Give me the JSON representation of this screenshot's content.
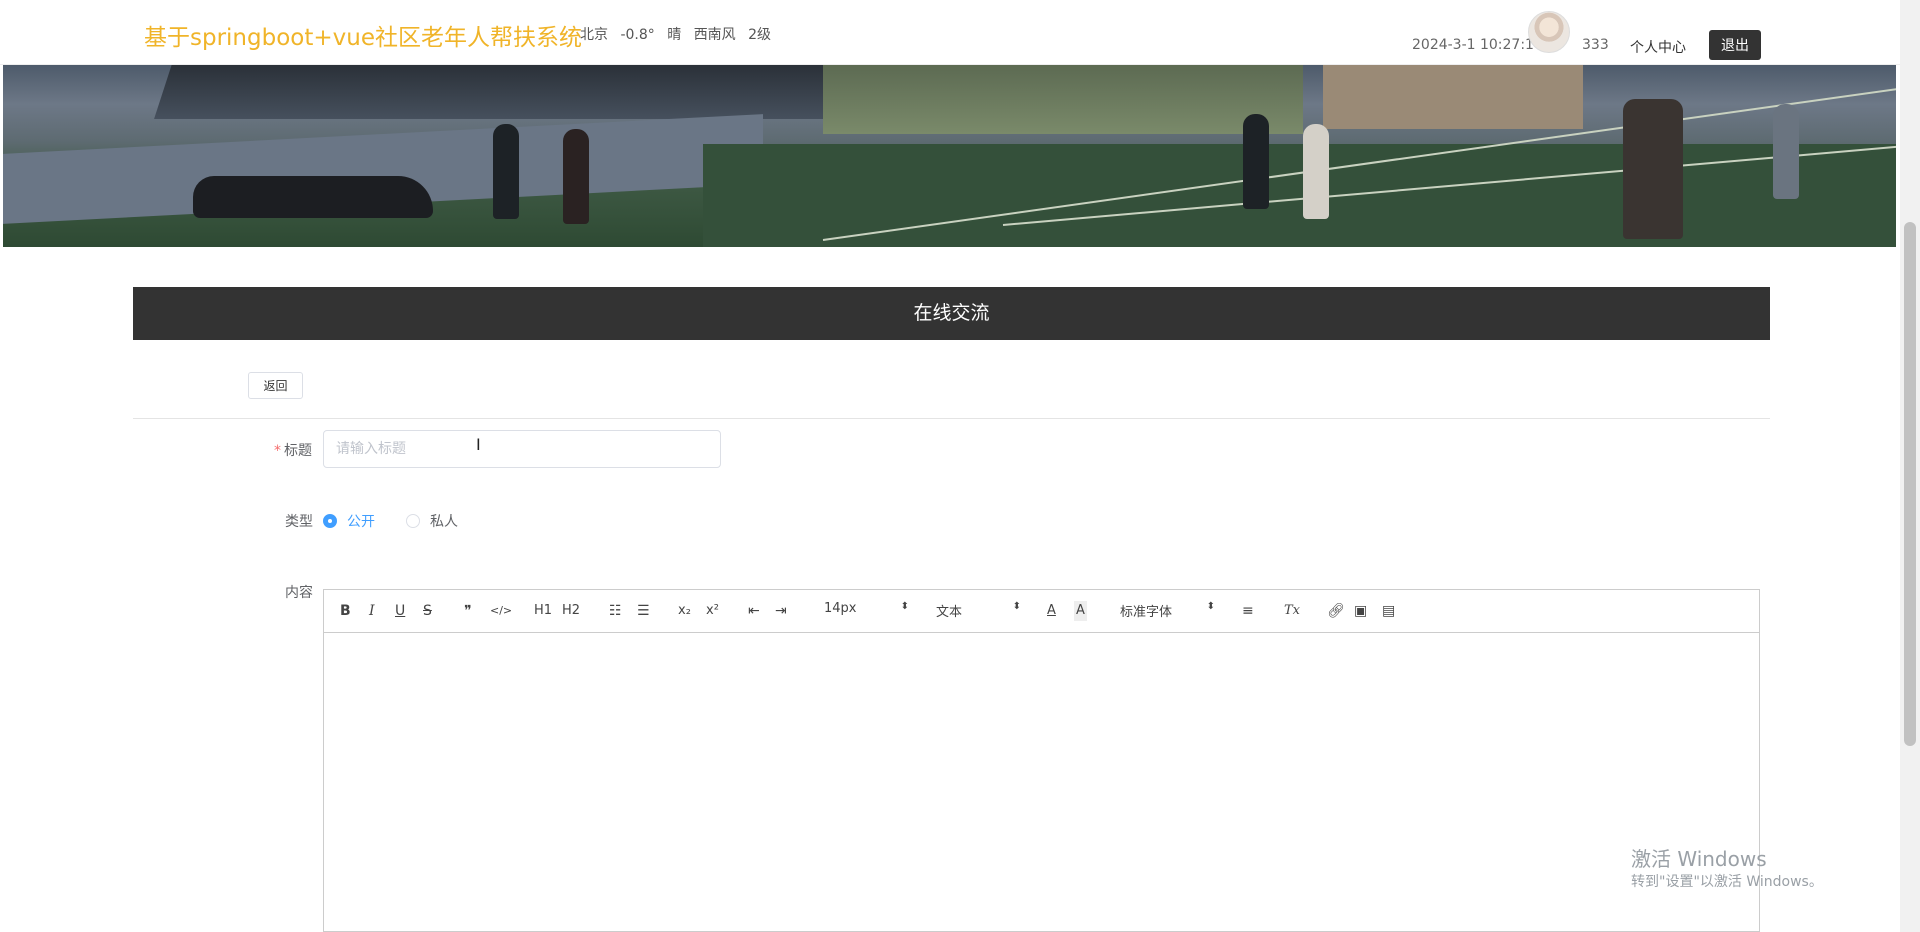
{
  "header": {
    "title": "基于springboot+vue社区老年人帮扶系统",
    "weather": {
      "city": "北京",
      "temp": "-0.8°",
      "condition": "晴",
      "wind": "西南风",
      "level": "2级"
    },
    "datetime": "2024-3-1 10:27:1",
    "username": "333",
    "user_center": "个人中心",
    "logout": "退出"
  },
  "banner": {
    "slides": 3,
    "active_slide": 1
  },
  "section": {
    "title": "在线交流"
  },
  "back_button": "返回",
  "form": {
    "title_label": "标题",
    "title_placeholder": "请输入标题",
    "title_value": "",
    "type_label": "类型",
    "type_options": [
      "公开",
      "私人"
    ],
    "type_selected": "公开",
    "content_label": "内容"
  },
  "editor": {
    "font_size": "14px",
    "header_select": "文本",
    "font_family": "标准字体",
    "tools": {
      "bold": "B",
      "italic": "I",
      "underline": "U",
      "strike": "S",
      "blockquote": "❞",
      "code": "</>",
      "h1": "H1",
      "h2": "H2",
      "superscript": "x²",
      "subscript": "x₂",
      "clean": "Tx"
    }
  },
  "watermark": {
    "line1": "激活 Windows",
    "line2": "转到\"设置\"以激活 Windows。"
  },
  "colors": {
    "title": "#f0b429",
    "dark_bar": "#333333",
    "radio_active": "#409eff"
  }
}
